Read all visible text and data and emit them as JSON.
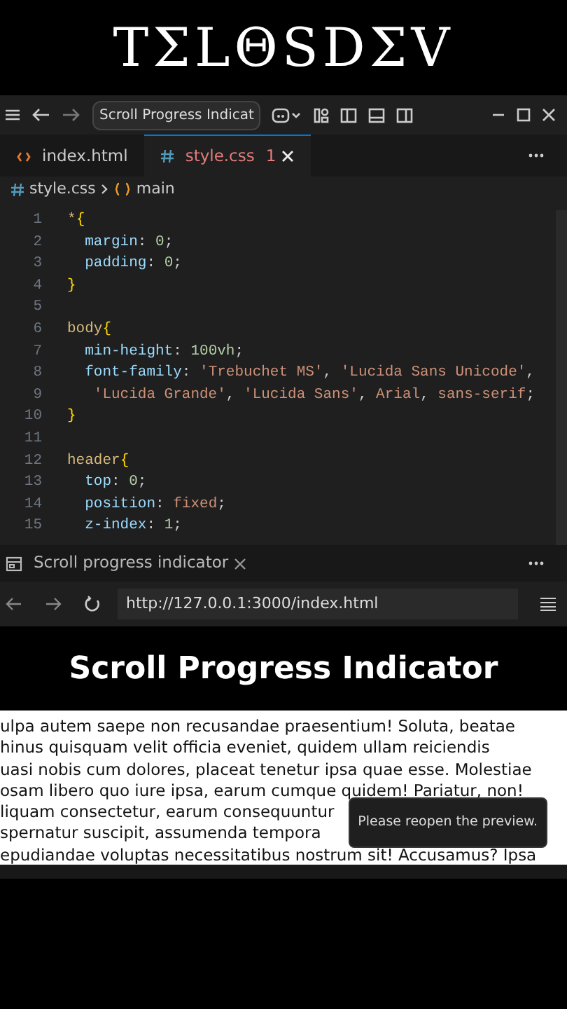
{
  "logo": "TΣLΘSDΣV",
  "title_bar": {
    "search_text": "Scroll Progress Indicat"
  },
  "editor_tabs": [
    {
      "label": "index.html",
      "selected": false
    },
    {
      "label": "style.css",
      "problems": "1",
      "selected": true
    }
  ],
  "breadcrumb": {
    "file": "style.css",
    "symbol": "main"
  },
  "code_lines": [
    {
      "number": "1",
      "kind": "rule",
      "tokens": [
        {
          "kind": "sel",
          "t": "*"
        },
        {
          "kind": "brace",
          "t": "{"
        }
      ]
    },
    {
      "number": "2",
      "kind": "declaration",
      "tokens": [
        {
          "kind": "prop",
          "t": "margin"
        },
        {
          "kind": "punct",
          "t": ": "
        },
        {
          "kind": "num",
          "t": "0"
        },
        {
          "kind": "punct",
          "t": ";"
        }
      ]
    },
    {
      "number": "3",
      "kind": "declaration",
      "tokens": [
        {
          "kind": "prop",
          "t": "padding"
        },
        {
          "kind": "punct",
          "t": ": "
        },
        {
          "kind": "num",
          "t": "0"
        },
        {
          "kind": "punct",
          "t": ";"
        }
      ]
    },
    {
      "number": "4",
      "kind": "rule",
      "tokens": [
        {
          "kind": "brace",
          "t": "}"
        }
      ]
    },
    {
      "number": "5",
      "kind": "blank"
    },
    {
      "number": "6",
      "kind": "rule",
      "tokens": [
        {
          "kind": "sel",
          "t": "body"
        },
        {
          "kind": "brace",
          "t": "{"
        }
      ]
    },
    {
      "number": "7",
      "kind": "declaration",
      "tokens": [
        {
          "kind": "prop",
          "t": "min-height"
        },
        {
          "kind": "punct",
          "t": ": "
        },
        {
          "kind": "num",
          "t": "100vh"
        },
        {
          "kind": "punct",
          "t": ";"
        }
      ]
    },
    {
      "number": "8",
      "kind": "declaration",
      "tokens": [
        {
          "kind": "prop",
          "t": "font-family"
        },
        {
          "kind": "punct",
          "t": ": "
        },
        {
          "kind": "str",
          "t": "'Trebuchet MS'"
        },
        {
          "kind": "punct",
          "t": ", "
        },
        {
          "kind": "str",
          "t": "'Lucida Sans Unicode'"
        },
        {
          "kind": "punct",
          "t": ","
        }
      ]
    },
    {
      "number": "9",
      "kind": "continuation",
      "tokens": [
        {
          "kind": "str",
          "t": "'Lucida Grande'"
        },
        {
          "kind": "punct",
          "t": ", "
        },
        {
          "kind": "str",
          "t": "'Lucida Sans'"
        },
        {
          "kind": "punct",
          "t": ", "
        },
        {
          "kind": "str",
          "t": "Arial"
        },
        {
          "kind": "punct",
          "t": ", "
        },
        {
          "kind": "str",
          "t": "sans-serif"
        },
        {
          "kind": "punct",
          "t": ";"
        }
      ]
    },
    {
      "number": "10",
      "kind": "rule",
      "tokens": [
        {
          "kind": "brace",
          "t": "}"
        }
      ]
    },
    {
      "number": "11",
      "kind": "blank"
    },
    {
      "number": "12",
      "kind": "rule",
      "tokens": [
        {
          "kind": "sel",
          "t": "header"
        },
        {
          "kind": "brace",
          "t": "{"
        }
      ]
    },
    {
      "number": "13",
      "kind": "declaration",
      "tokens": [
        {
          "kind": "prop",
          "t": "top"
        },
        {
          "kind": "punct",
          "t": ": "
        },
        {
          "kind": "num",
          "t": "0"
        },
        {
          "kind": "punct",
          "t": ";"
        }
      ]
    },
    {
      "number": "14",
      "kind": "declaration",
      "tokens": [
        {
          "kind": "prop",
          "t": "position"
        },
        {
          "kind": "punct",
          "t": ": "
        },
        {
          "kind": "str",
          "t": "fixed"
        },
        {
          "kind": "punct",
          "t": ";"
        }
      ]
    },
    {
      "number": "15",
      "kind": "declaration",
      "tokens": [
        {
          "kind": "prop",
          "t": "z-index"
        },
        {
          "kind": "punct",
          "t": ": "
        },
        {
          "kind": "num",
          "t": "1"
        },
        {
          "kind": "punct",
          "t": ";"
        }
      ]
    }
  ],
  "preview_panel": {
    "tab_label": "Scroll progress indicator",
    "url": "http://127.0.0.1:3000/index.html"
  },
  "page": {
    "heading": "Scroll Progress Indicator",
    "lines": [
      "ulpa autem saepe non recusandae praesentium! Soluta, beatae",
      "hinus quisquam velit officia eveniet, quidem ullam reiciendis",
      "uasi nobis cum dolores, placeat tenetur ipsa quae esse. Molestiae",
      "osam libero quo iure ipsa, earum cumque quidem! Pariatur, non!",
      "liquam consectetur, earum consequuntur",
      "spernatur suscipit, assumenda tempora",
      "epudiandae voluptas necessitatibus nostrum sit! Accusamus? Ipsa"
    ]
  },
  "toast": "Please reopen the preview."
}
